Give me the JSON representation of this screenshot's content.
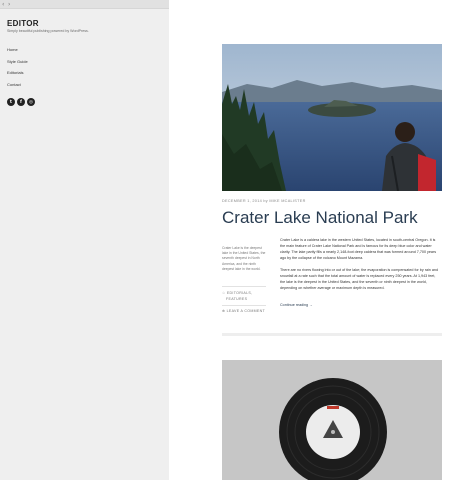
{
  "topbar": {
    "glyph_left": "‹",
    "glyph_right": "›"
  },
  "site": {
    "title": "EDITOR",
    "tagline": "Simply beautiful publishing powered by WordPress."
  },
  "menu": {
    "items": [
      {
        "label": "Home"
      },
      {
        "label": "Style Guide"
      },
      {
        "label": "Editorials"
      },
      {
        "label": "Contact"
      }
    ]
  },
  "social": {
    "icons": [
      "twitter-icon",
      "facebook-icon",
      "instagram-icon"
    ],
    "glyphs": [
      "t",
      "f",
      "◎"
    ]
  },
  "post": {
    "meta": "DECEMBER 1, 2014 by MIKE MCALISTER",
    "title": "Crater Lake National Park",
    "excerpt": "Crater Lake is the deepest lake in the United States, the seventh deepest in North America, and the ninth deepest lake in the world.",
    "tag_line1": "☆ EDITORIALS,",
    "tag_line2": "FEATURES",
    "comment_link": "⊕ LEAVE A COMMENT",
    "paragraph1": "Crater Lake is a caldera lake in the western United States, located in south-central Oregon. It is the main feature of Crater Lake National Park and is famous for its deep blue color and water clarity. The lake partly fills a nearly 2,148-foot deep caldera that was formed around 7,700 years ago by the collapse of the volcano Mount Mazama.",
    "paragraph2": "There are no rivers flowing into or out of the lake; the evaporation is compensated for by rain and snowfall at a rate such that the total amount of water is replaced every 250 years. At 1,943 feet, the lake is the deepest in the United States, and the seventh or ninth deepest in the world, depending on whether average or maximum depth is measured.",
    "continue_reading": "Continue reading →"
  },
  "colors": {
    "sidebar_bg": "#efefef",
    "title_link": "#2a3d52",
    "lake": "#2f4f82"
  }
}
